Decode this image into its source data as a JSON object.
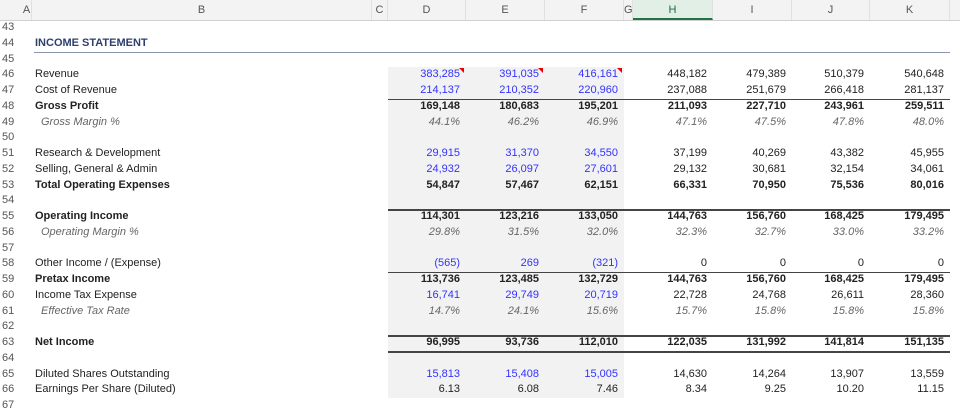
{
  "columns": [
    "A",
    "B",
    "C",
    "D",
    "E",
    "F",
    "G",
    "H",
    "I",
    "J",
    "K"
  ],
  "selected_column": "H",
  "title": {
    "row": 44,
    "label": "INCOME STATEMENT"
  },
  "rows": [
    {
      "row": 43
    },
    {
      "row": 44
    },
    {
      "row": 45
    },
    {
      "row": 46,
      "label": "Revenue",
      "values": [
        "383,285",
        "391,035",
        "416,161",
        "448,182",
        "479,389",
        "510,379",
        "540,648"
      ],
      "input": true,
      "comment": true
    },
    {
      "row": 47,
      "label": "Cost of Revenue",
      "values": [
        "214,137",
        "210,352",
        "220,960",
        "237,088",
        "251,679",
        "266,418",
        "281,137"
      ],
      "input": true
    },
    {
      "row": 48,
      "label": "Gross Profit",
      "style": "b",
      "values": [
        "169,148",
        "180,683",
        "195,201",
        "211,093",
        "227,710",
        "243,961",
        "259,511"
      ],
      "border": "thin"
    },
    {
      "row": 49,
      "label": "Gross Margin %",
      "style": "i",
      "values": [
        "44.1%",
        "46.2%",
        "46.9%",
        "47.1%",
        "47.5%",
        "47.8%",
        "48.0%"
      ]
    },
    {
      "row": 50
    },
    {
      "row": 51,
      "label": "Research & Development",
      "values": [
        "29,915",
        "31,370",
        "34,550",
        "37,199",
        "40,269",
        "43,382",
        "45,955"
      ],
      "input": true
    },
    {
      "row": 52,
      "label": "Selling, General & Admin",
      "values": [
        "24,932",
        "26,097",
        "27,601",
        "29,132",
        "30,681",
        "32,154",
        "34,061"
      ],
      "input": true
    },
    {
      "row": 53,
      "label": "Total Operating Expenses",
      "style": "b",
      "values": [
        "54,847",
        "57,467",
        "62,151",
        "66,331",
        "70,950",
        "75,536",
        "80,016"
      ]
    },
    {
      "row": 54
    },
    {
      "row": 55,
      "label": "Operating Income",
      "style": "b",
      "values": [
        "114,301",
        "123,216",
        "133,050",
        "144,763",
        "156,760",
        "168,425",
        "179,495"
      ],
      "border": "thick"
    },
    {
      "row": 56,
      "label": "Operating Margin %",
      "style": "i",
      "values": [
        "29.8%",
        "31.5%",
        "32.0%",
        "32.3%",
        "32.7%",
        "33.0%",
        "33.2%"
      ]
    },
    {
      "row": 57
    },
    {
      "row": 58,
      "label": "Other Income / (Expense)",
      "values": [
        "(565)",
        "269",
        "(321)",
        "0",
        "0",
        "0",
        "0"
      ],
      "input": true
    },
    {
      "row": 59,
      "label": "Pretax Income",
      "style": "b",
      "values": [
        "113,736",
        "123,485",
        "132,729",
        "144,763",
        "156,760",
        "168,425",
        "179,495"
      ],
      "border": "thin"
    },
    {
      "row": 60,
      "label": "Income Tax Expense",
      "values": [
        "16,741",
        "29,749",
        "20,719",
        "22,728",
        "24,768",
        "26,611",
        "28,360"
      ],
      "input": true
    },
    {
      "row": 61,
      "label": "Effective Tax Rate",
      "style": "i",
      "values": [
        "14.7%",
        "24.1%",
        "15.6%",
        "15.7%",
        "15.8%",
        "15.8%",
        "15.8%"
      ]
    },
    {
      "row": 62
    },
    {
      "row": 63,
      "label": "Net Income",
      "style": "b",
      "values": [
        "96,995",
        "93,736",
        "112,010",
        "122,035",
        "131,992",
        "141,814",
        "151,135"
      ],
      "border": "thick",
      "border_bottom": true
    },
    {
      "row": 64
    },
    {
      "row": 65,
      "label": "Diluted Shares Outstanding",
      "values": [
        "15,813",
        "15,408",
        "15,005",
        "14,630",
        "14,264",
        "13,907",
        "13,559"
      ],
      "input": true
    },
    {
      "row": 66,
      "label": "Earnings Per Share (Diluted)",
      "values": [
        "6.13",
        "6.08",
        "7.46",
        "8.34",
        "9.25",
        "10.20",
        "11.15"
      ]
    },
    {
      "row": 67
    }
  ]
}
